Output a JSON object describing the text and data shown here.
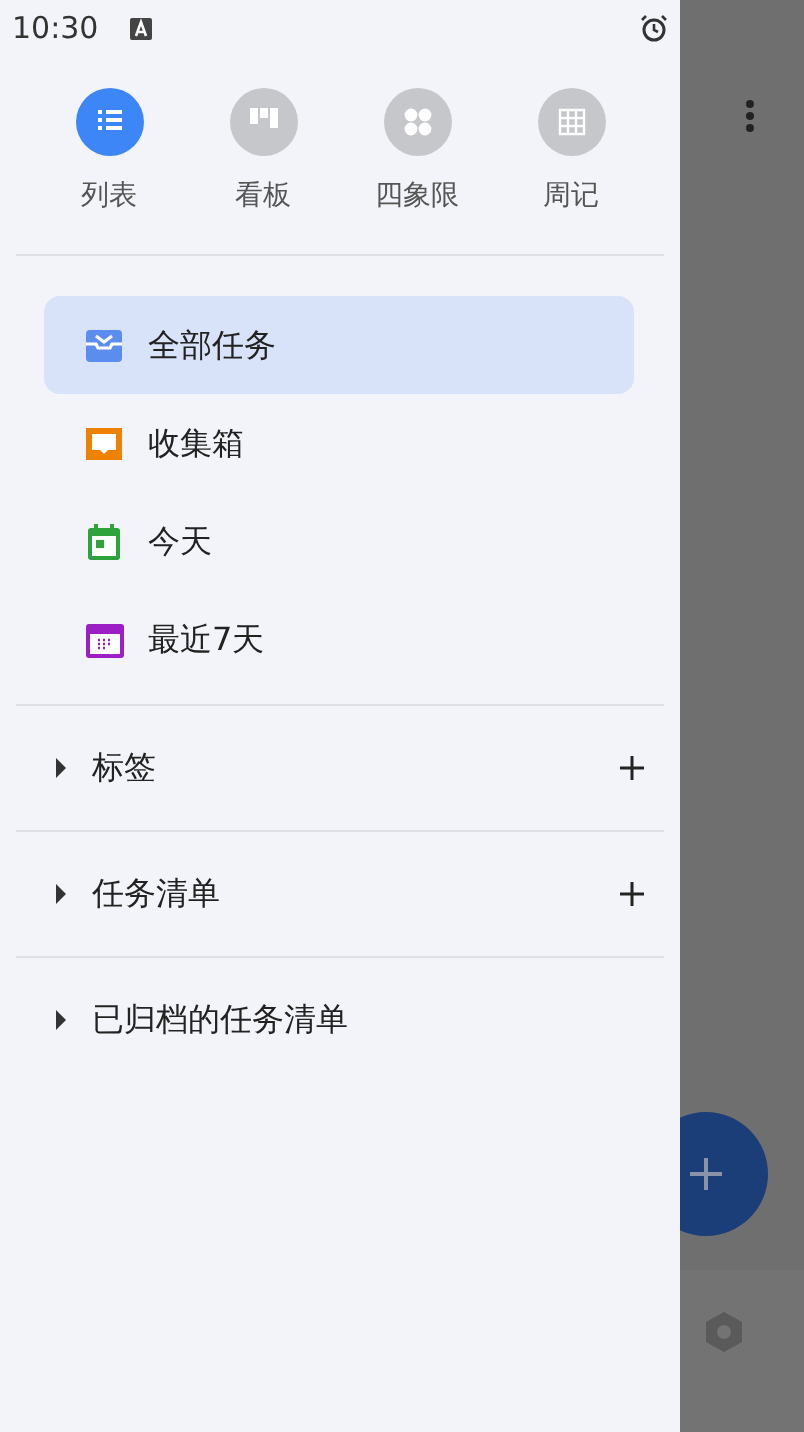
{
  "status_bar": {
    "time": "10:30"
  },
  "view_tabs": [
    {
      "label": "列表",
      "kind": "list",
      "selected": true
    },
    {
      "label": "看板",
      "kind": "board",
      "selected": false
    },
    {
      "label": "四象限",
      "kind": "matrix",
      "selected": false
    },
    {
      "label": "周记",
      "kind": "week",
      "selected": false
    }
  ],
  "smart_lists": [
    {
      "label": "全部任务",
      "kind": "all",
      "selected": true
    },
    {
      "label": "收集箱",
      "kind": "inbox",
      "selected": false
    },
    {
      "label": "今天",
      "kind": "today",
      "selected": false
    },
    {
      "label": "最近7天",
      "kind": "next7",
      "selected": false
    }
  ],
  "sections": [
    {
      "label": "标签",
      "expanded": false,
      "addable": true
    },
    {
      "label": "任务清单",
      "expanded": false,
      "addable": true
    },
    {
      "label": "已归档的任务清单",
      "expanded": false,
      "addable": false
    }
  ]
}
